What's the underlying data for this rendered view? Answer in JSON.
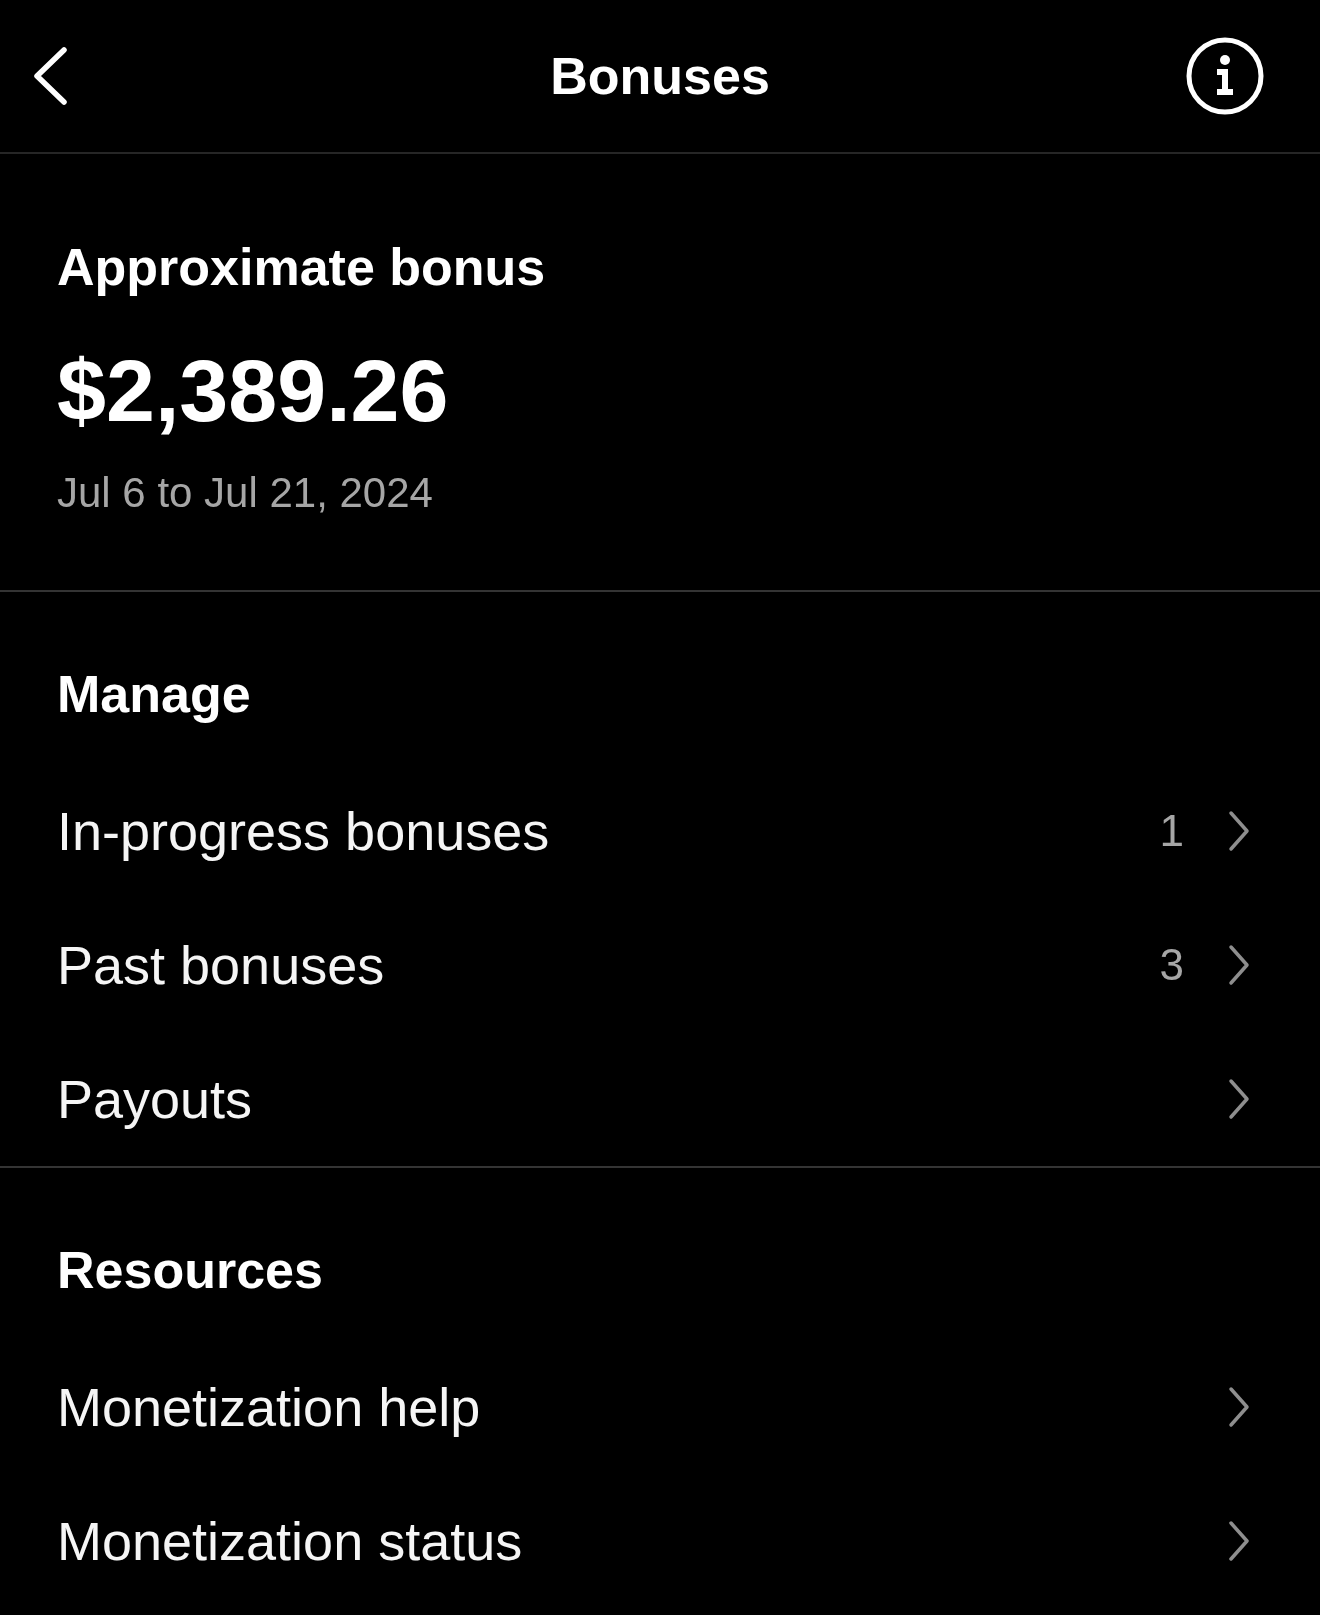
{
  "header": {
    "title": "Bonuses"
  },
  "summary": {
    "label": "Approximate bonus",
    "amount": "$2,389.26",
    "period": "Jul 6 to Jul 21, 2024"
  },
  "sections": [
    {
      "title": "Manage",
      "items": [
        {
          "label": "In-progress bonuses",
          "count": "1"
        },
        {
          "label": "Past bonuses",
          "count": "3"
        },
        {
          "label": "Payouts"
        }
      ]
    },
    {
      "title": "Resources",
      "items": [
        {
          "label": "Monetization help"
        },
        {
          "label": "Monetization status"
        }
      ]
    }
  ]
}
